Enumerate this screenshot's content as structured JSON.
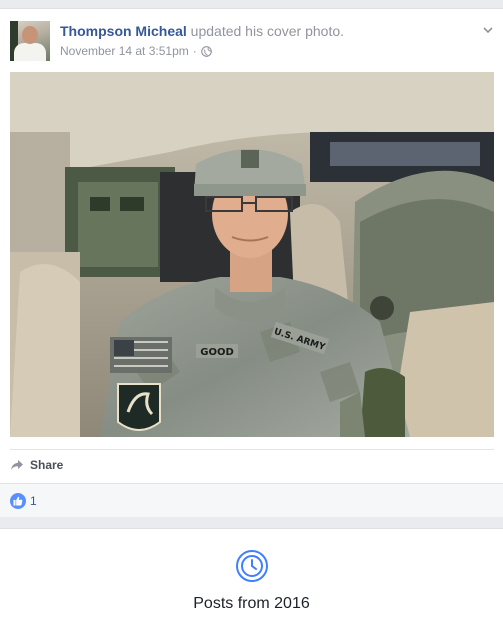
{
  "post": {
    "author": "Thompson Micheal",
    "action": " updated his cover photo.",
    "timestamp": "November 14 at 3:51pm",
    "separator": "·",
    "privacy_icon": "globe-icon",
    "menu_icon": "chevron-down-icon",
    "photo_alt": "Cover photo of a soldier seated in a military vehicle",
    "photo_text": {
      "name_tape": "GOOD",
      "branch_tape": "U.S. ARMY"
    }
  },
  "actions": {
    "share_label": "Share",
    "share_icon": "share-arrow-icon"
  },
  "reactions": {
    "like_icon": "like-thumb-icon",
    "count": "1"
  },
  "year_section": {
    "icon": "clock-icon",
    "title": "Posts from 2016"
  },
  "colors": {
    "link": "#365899",
    "meta": "#90949c",
    "accent": "#5890ff",
    "background": "#e9ebee"
  }
}
